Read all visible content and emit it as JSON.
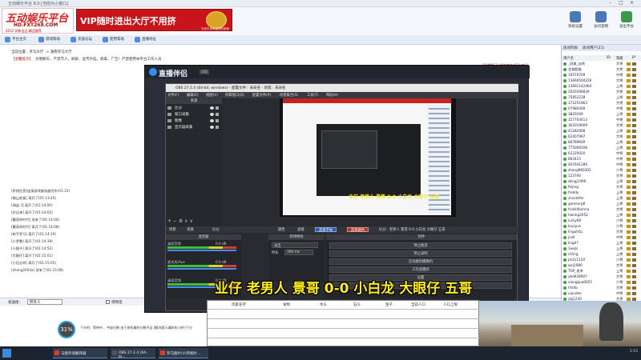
{
  "titlebar": {
    "title": "五动娱乐平台 8.0 [当前为小窗口]"
  },
  "logo": {
    "line1": "五动娱乐平台",
    "line2": "HD.FXT268.COM",
    "line3": "2012 邦和出品 精品推荐"
  },
  "vip": {
    "text": "VIP随时进出大厅不用挤",
    "sub": "五动平台欢迎您的到来"
  },
  "topicons": [
    {
      "label": "系统设置"
    },
    {
      "label": "访问官网"
    },
    {
      "label": "退出平台"
    }
  ],
  "nav": {
    "items": [
      "平台主页",
      "游戏帮助",
      "充值论坛",
      "使用帮助",
      "直播地址"
    ]
  },
  "info": {
    "location": "当前位置：罗马大厅 -> 湖南罗马大厅",
    "notice_label": "【温馨提示】",
    "notice": "文明聊天，严禁骂人，刷屏，宣传外挂，病毒，广告！严禁使用本平台工作人员",
    "right_notice": "【温馨提示】将被禁言或T出房间"
  },
  "chat": {
    "system": "[系统信息]连接游戏服务器完毕(V1.21)",
    "lines": [
      "[微山老板] 离开了(01:13:45)",
      "[海盗 3] 离开了(01:14:00)",
      "[好运来] 离开了(01:14:02)",
      "[赢家的时代] 进来了(01:14:04)",
      "[赢家的时代] 离开了(01:14:08)",
      "[新手罗马] 离开了(01:14:19)",
      "[小罗鹏] 离开了(01:14:39)",
      "[小猴子] 离开了(01:14:52)",
      "[大眼仔] 离开了(01:15:01)",
      "[小伍吉祥] 离开了(01:15:05)",
      "[zhang2003a] 进来了(01:15:08)"
    ]
  },
  "inputbar": {
    "label": "发送给：",
    "target": "所有人",
    "checkbox": "悄悄话"
  },
  "statusbar": {
    "text": "下分时，等待中... 中部分数 由于你所属的分数不足 [解决提示请联系] 进行下分"
  },
  "obs": {
    "brand": "直播伴侣",
    "brand_tag": "试用",
    "window_title": "OBS 27.2.4 (64-bit, windows) - 配置文件：未命名 - 场景：未命名",
    "menu": [
      "文件(F)",
      "编辑(E)",
      "视图(V)",
      "停靠窗口(D)",
      "配置文件(P)",
      "场景集合(S)",
      "工具(T)",
      "帮助(H)"
    ],
    "sources_header": "来源",
    "sources": [
      "比分",
      "窗口采集",
      "图像",
      "显示器采集"
    ],
    "scene_tabs": [
      "场景",
      "来源"
    ],
    "ctrl_label": "比分",
    "attr_btns": [
      "属性",
      "滤镜"
    ],
    "action_btns": [
      "选择字体",
      "选择颜色"
    ],
    "live_text": "比分：老男人 景哥 0-0 小白龙 大眼仔 五哥",
    "mixer_header": "混音器",
    "mixer": [
      {
        "name": "桌面音频",
        "db": "0.0 dB"
      },
      {
        "name": "麦克风/Aux",
        "db": "0.0 dB"
      },
      {
        "name": "桌面音频",
        "db": "0.0 dB"
      }
    ],
    "trans_header": "转场特效",
    "trans_value": "淡出",
    "trans_dur_label": "时长",
    "trans_dur": "300 ms",
    "controls_header": "控件",
    "controls": [
      "停止推流",
      "停止录制",
      "启动虚拟摄像机",
      "工作室模式",
      "设置",
      "退出"
    ],
    "stats": "LIVE: 00:10:23  REC: 00:10:23  CPU: 6.2%, 30.00 fps"
  },
  "overlay_caption": "业仔 老男人 景哥 0-0 小白龙 大眼仔 五哥",
  "sheet": {
    "headers": [
      "玩家名字",
      "食物",
      "木头",
      "石头",
      "金子",
      "当前人口",
      "人口上限"
    ]
  },
  "rightpanel": {
    "tabs": [
      "房间列表",
      "房间用户(21)"
    ],
    "cols": [
      "用户名",
      "ID",
      "等级",
      "IP"
    ],
    "users": [
      [
        "_同美_自然",
        "大将"
      ],
      [
        "金城超级",
        "大将"
      ],
      [
        "19570709",
        "中将"
      ],
      [
        "13660504226",
        "大将"
      ],
      [
        "13691142464",
        "上将"
      ],
      [
        "2020396839",
        "大将"
      ],
      [
        "75852228",
        "上将"
      ],
      [
        "172251963",
        "大将"
      ],
      [
        "07980448",
        "中将"
      ],
      [
        "3820199",
        "上将"
      ],
      [
        "327704413",
        "中将"
      ],
      [
        "362019009",
        "大将"
      ],
      [
        "41282908",
        "上将"
      ],
      [
        "62407997",
        "大将"
      ],
      [
        "80789609",
        "上将"
      ],
      [
        "775006508",
        "上将"
      ],
      [
        "62220020",
        "中将"
      ],
      [
        "863415",
        "中将"
      ],
      [
        "467641286",
        "中将"
      ],
      [
        "zhang960302",
        "少将"
      ],
      [
        "123700",
        "大将"
      ],
      [
        "dongj1990",
        "上将"
      ],
      [
        "feijing",
        "大将"
      ],
      [
        "freddy",
        "上将"
      ],
      [
        "chocktfer",
        "上将"
      ],
      [
        "gamexrg8",
        "上将"
      ],
      [
        "frankllbanna",
        "大将"
      ],
      [
        "hoking2052",
        "上将"
      ],
      [
        "lucky66",
        "少将"
      ],
      [
        "kouiyun",
        "少将"
      ],
      [
        "linguhfzj",
        "大将"
      ],
      [
        "jnsll",
        "中将"
      ],
      [
        "ling47",
        "上将"
      ],
      [
        "1wqis",
        "上将"
      ],
      [
        "z1ling",
        "上将"
      ],
      [
        "ph2y1120",
        "少将"
      ],
      [
        "wxj1980",
        "大将"
      ],
      [
        "TOP_老李",
        "上将"
      ],
      [
        "ybd928907",
        "大将"
      ],
      [
        "xiangqua0655",
        "少将"
      ],
      [
        "hfxhb",
        "大将"
      ],
      [
        "uiyudee",
        "中将"
      ],
      [
        "ybj1230",
        "大将"
      ],
      [
        "wujlzv",
        "少将"
      ],
      [
        "xsq0704",
        "少将"
      ],
      [
        "yyd1004",
        "大将"
      ]
    ]
  },
  "gauge": {
    "value": "31%"
  },
  "taskbar": {
    "items": [
      "马图奈语翻译器",
      "OBS 27.2.4 (64-bi...",
      "罗马图片(V)单图片..."
    ],
    "clock": "1:15"
  }
}
